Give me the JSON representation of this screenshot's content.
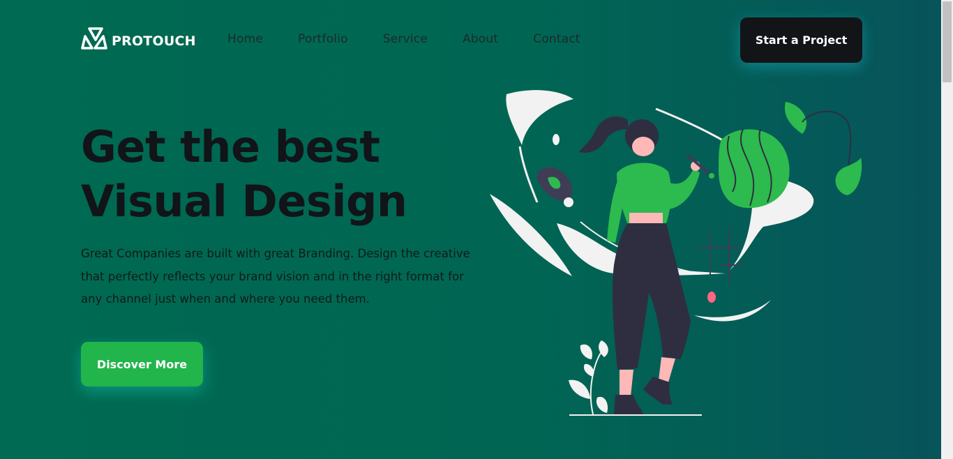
{
  "brand": {
    "name": "PROTOUCH",
    "icon": "triangle-knot-logo-icon"
  },
  "nav": [
    {
      "label": "Home"
    },
    {
      "label": "Portfolio"
    },
    {
      "label": "Service"
    },
    {
      "label": "About"
    },
    {
      "label": "Contact"
    }
  ],
  "header_cta": "Start a Project",
  "hero": {
    "title_line1": "Get the best",
    "title_line2": "Visual Design",
    "text": "Great Companies are built with great Branding. Design the creative that perfectly reflects your brand vision and in the right format for any channel just when and where you need them.",
    "button": "Discover More"
  },
  "colors": {
    "accent": "#22b54c",
    "dark": "#121418",
    "bg_start": "#006a52",
    "bg_end": "#07535b"
  },
  "illustration": "woman-painting-illustration"
}
